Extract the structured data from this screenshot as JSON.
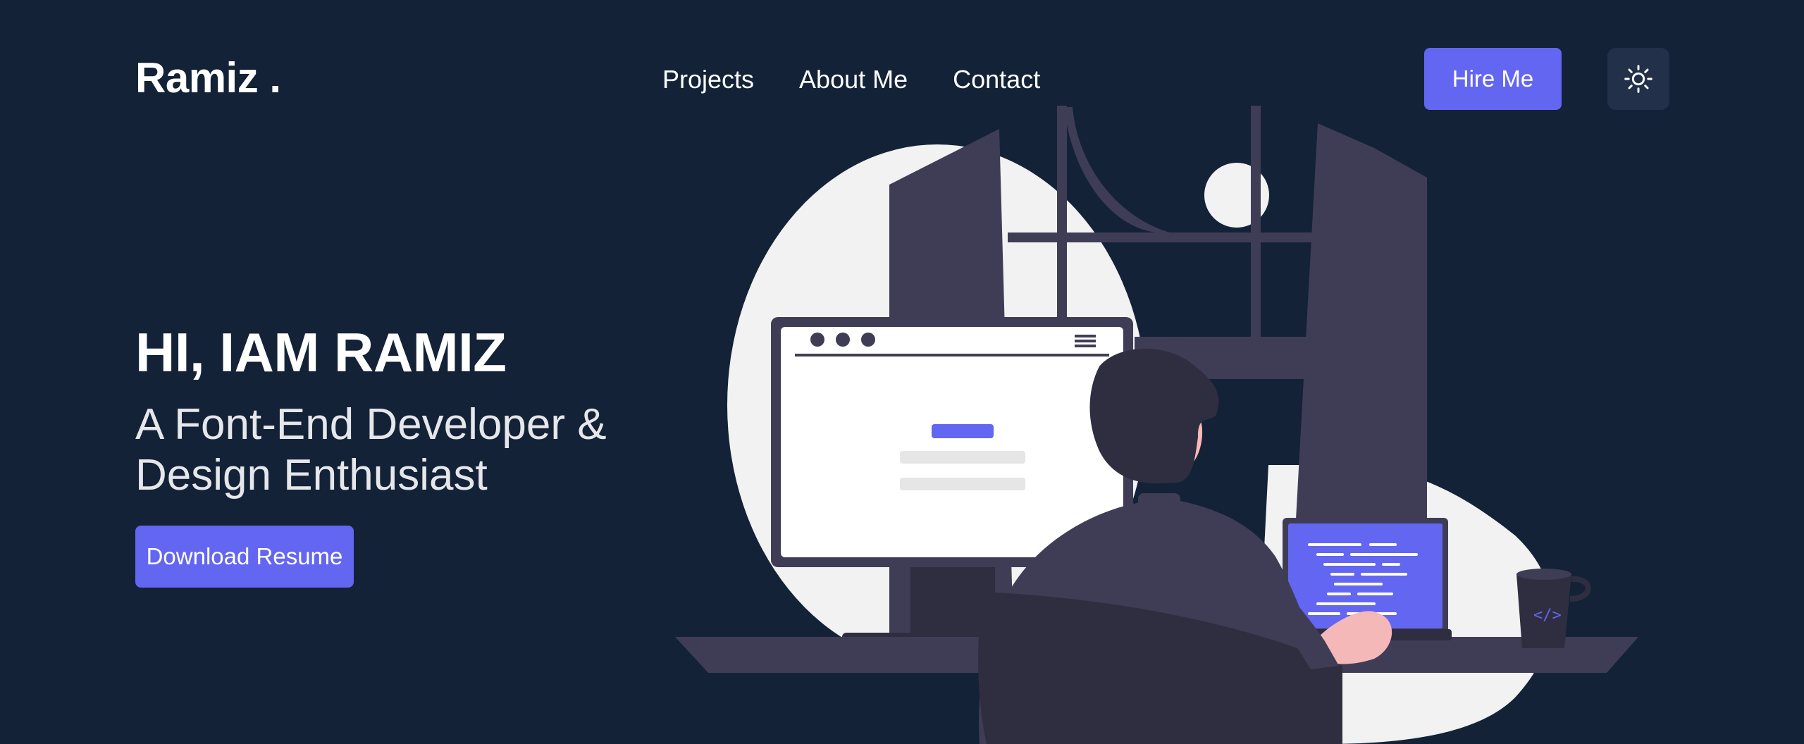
{
  "header": {
    "logo": "Ramiz .",
    "nav": [
      {
        "label": "Projects"
      },
      {
        "label": "About Me"
      },
      {
        "label": "Contact"
      }
    ],
    "hire_label": "Hire Me",
    "theme_icon": "sun-icon"
  },
  "hero": {
    "title": "HI, IAM RAMIZ",
    "subtitle": "A Font-End Developer & Design Enthusiast",
    "download_label": "Download Resume",
    "illustration": "developer-at-desk"
  },
  "colors": {
    "background": "#132237",
    "accent": "#6366f1",
    "icon_button": "#223149"
  }
}
